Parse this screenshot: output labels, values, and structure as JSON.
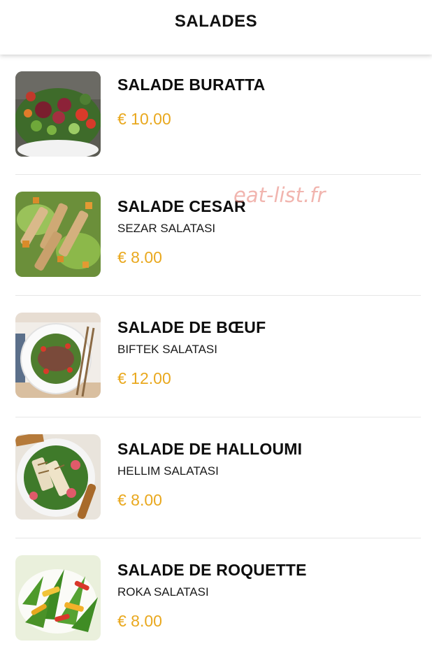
{
  "header": {
    "title": "SALADES"
  },
  "watermark": "eat-list.fr",
  "items": [
    {
      "name": "SALADE BURATTA",
      "subtitle": "",
      "price": "€ 10.00",
      "image_icon": "buratta-salad-photo"
    },
    {
      "name": "SALADE CESAR",
      "subtitle": "SEZAR SALATASI",
      "price": "€ 8.00",
      "image_icon": "caesar-salad-photo"
    },
    {
      "name": "SALADE DE BŒUF",
      "subtitle": "BIFTEK SALATASI",
      "price": "€ 12.00",
      "image_icon": "beef-salad-photo"
    },
    {
      "name": "SALADE DE HALLOUMI",
      "subtitle": "HELLIM SALATASI",
      "price": "€ 8.00",
      "image_icon": "halloumi-salad-photo"
    },
    {
      "name": "SALADE DE ROQUETTE",
      "subtitle": "ROKA SALATASI",
      "price": "€ 8.00",
      "image_icon": "rocket-salad-photo"
    }
  ],
  "colors": {
    "price": "#e9a81e",
    "divider": "#e6e6e6"
  }
}
